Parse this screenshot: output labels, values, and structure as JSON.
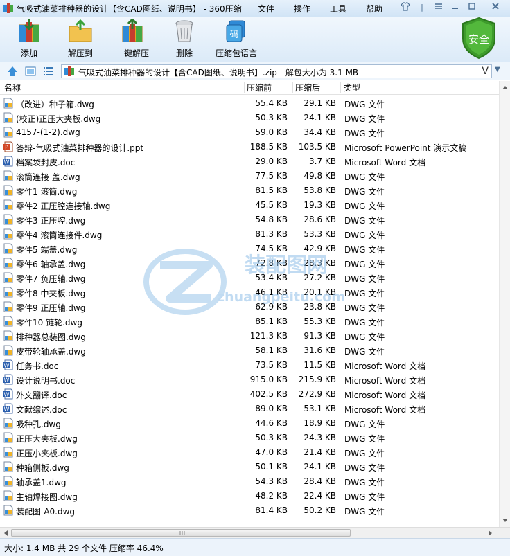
{
  "app": {
    "title": "气吸式油菜排种器的设计【含CAD图纸、说明书】 - 360压缩",
    "menu": [
      "文件",
      "操作",
      "工具",
      "帮助"
    ]
  },
  "toolbar": {
    "buttons": [
      "添加",
      "解压到",
      "一键解压",
      "删除",
      "压缩包语言"
    ],
    "safe_badge": "安全"
  },
  "address": {
    "text": "气吸式油菜排种器的设计【含CAD图纸、说明书】.zip - 解包大小为 3.1 MB",
    "dropdown_glyph": "V"
  },
  "columns": {
    "name": "名称",
    "size": "压缩前",
    "compressed": "压缩后",
    "type": "类型"
  },
  "files": [
    {
      "name": "（改进）种子箱.dwg",
      "size": "55.4 KB",
      "csize": "29.1 KB",
      "type": "DWG 文件",
      "icon": "dwg"
    },
    {
      "name": "(校正)正压大夹板.dwg",
      "size": "50.3 KB",
      "csize": "24.1 KB",
      "type": "DWG 文件",
      "icon": "dwg"
    },
    {
      "name": "4157-(1-2).dwg",
      "size": "59.0 KB",
      "csize": "34.4 KB",
      "type": "DWG 文件",
      "icon": "dwg"
    },
    {
      "name": "答辩-气吸式油菜排种器的设计.ppt",
      "size": "188.5 KB",
      "csize": "103.5 KB",
      "type": "Microsoft PowerPoint 演示文稿",
      "icon": "ppt"
    },
    {
      "name": "档案袋封皮.doc",
      "size": "29.0 KB",
      "csize": "3.7 KB",
      "type": "Microsoft Word 文档",
      "icon": "doc"
    },
    {
      "name": "滚筒连接 盖.dwg",
      "size": "77.5 KB",
      "csize": "49.8 KB",
      "type": "DWG 文件",
      "icon": "dwg"
    },
    {
      "name": "零件1 滚筒.dwg",
      "size": "81.5 KB",
      "csize": "53.8 KB",
      "type": "DWG 文件",
      "icon": "dwg"
    },
    {
      "name": "零件2 正压腔连接轴.dwg",
      "size": "45.5 KB",
      "csize": "19.3 KB",
      "type": "DWG 文件",
      "icon": "dwg"
    },
    {
      "name": "零件3 正压腔.dwg",
      "size": "54.8 KB",
      "csize": "28.6 KB",
      "type": "DWG 文件",
      "icon": "dwg"
    },
    {
      "name": "零件4 滚筒连接件.dwg",
      "size": "81.3 KB",
      "csize": "53.3 KB",
      "type": "DWG 文件",
      "icon": "dwg"
    },
    {
      "name": "零件5 端盖.dwg",
      "size": "74.5 KB",
      "csize": "42.9 KB",
      "type": "DWG 文件",
      "icon": "dwg"
    },
    {
      "name": "零件6 轴承盖.dwg",
      "size": "72.8 KB",
      "csize": "28.3 KB",
      "type": "DWG 文件",
      "icon": "dwg"
    },
    {
      "name": "零件7 负压轴.dwg",
      "size": "53.4 KB",
      "csize": "27.2 KB",
      "type": "DWG 文件",
      "icon": "dwg"
    },
    {
      "name": "零件8 中夹板.dwg",
      "size": "46.1 KB",
      "csize": "20.1 KB",
      "type": "DWG 文件",
      "icon": "dwg"
    },
    {
      "name": "零件9 正压轴.dwg",
      "size": "62.9 KB",
      "csize": "23.8 KB",
      "type": "DWG 文件",
      "icon": "dwg"
    },
    {
      "name": "零件10 链轮.dwg",
      "size": "85.1 KB",
      "csize": "55.3 KB",
      "type": "DWG 文件",
      "icon": "dwg"
    },
    {
      "name": "排种器总装图.dwg",
      "size": "121.3 KB",
      "csize": "91.3 KB",
      "type": "DWG 文件",
      "icon": "dwg"
    },
    {
      "name": "皮带轮轴承盖.dwg",
      "size": "58.1 KB",
      "csize": "31.6 KB",
      "type": "DWG 文件",
      "icon": "dwg"
    },
    {
      "name": "任务书.doc",
      "size": "73.5 KB",
      "csize": "11.5 KB",
      "type": "Microsoft Word 文档",
      "icon": "doc"
    },
    {
      "name": "设计说明书.doc",
      "size": "915.0 KB",
      "csize": "215.9 KB",
      "type": "Microsoft Word 文档",
      "icon": "doc"
    },
    {
      "name": "外文翻译.doc",
      "size": "402.5 KB",
      "csize": "272.9 KB",
      "type": "Microsoft Word 文档",
      "icon": "doc"
    },
    {
      "name": "文献综述.doc",
      "size": "89.0 KB",
      "csize": "53.1 KB",
      "type": "Microsoft Word 文档",
      "icon": "doc"
    },
    {
      "name": "吸种孔.dwg",
      "size": "44.6 KB",
      "csize": "18.9 KB",
      "type": "DWG 文件",
      "icon": "dwg"
    },
    {
      "name": "正压大夹板.dwg",
      "size": "50.3 KB",
      "csize": "24.3 KB",
      "type": "DWG 文件",
      "icon": "dwg"
    },
    {
      "name": "正压小夹板.dwg",
      "size": "47.0 KB",
      "csize": "21.4 KB",
      "type": "DWG 文件",
      "icon": "dwg"
    },
    {
      "name": "种箱侧板.dwg",
      "size": "50.1 KB",
      "csize": "24.1 KB",
      "type": "DWG 文件",
      "icon": "dwg"
    },
    {
      "name": "轴承盖1.dwg",
      "size": "54.3 KB",
      "csize": "28.4 KB",
      "type": "DWG 文件",
      "icon": "dwg"
    },
    {
      "name": "主轴焊接图.dwg",
      "size": "48.2 KB",
      "csize": "22.4 KB",
      "type": "DWG 文件",
      "icon": "dwg"
    },
    {
      "name": "装配图-A0.dwg",
      "size": "81.4 KB",
      "csize": "50.2 KB",
      "type": "DWG 文件",
      "icon": "dwg"
    }
  ],
  "watermark": {
    "text_cn": "装配图网",
    "text_url": "zhuangpeitu.com"
  },
  "status": {
    "text": "大小: 1.4 MB 共 29 个文件 压缩率 46.4%"
  }
}
